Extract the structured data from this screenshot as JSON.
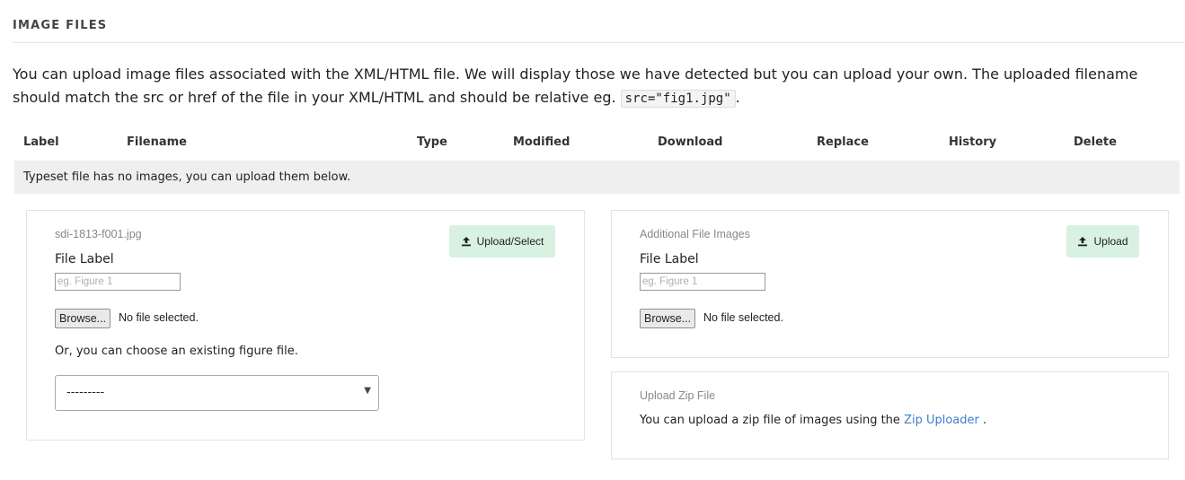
{
  "section": {
    "title": "IMAGE FILES"
  },
  "intro": {
    "text_before": "You can upload image files associated with the XML/HTML file. We will display those we have detected but you can upload your own. The uploaded filename should match the src or href of the file in your XML/HTML and should be relative eg. ",
    "code": "src=\"fig1.jpg\"",
    "text_after": "."
  },
  "table": {
    "headers": {
      "label": "Label",
      "filename": "Filename",
      "type": "Type",
      "modified": "Modified",
      "download": "Download",
      "replace": "Replace",
      "history": "History",
      "delete": "Delete"
    },
    "empty_message": "Typeset file has no images, you can upload them below."
  },
  "left_panel": {
    "filename": "sdi-1813-f001.jpg",
    "upload_label": "Upload/Select",
    "file_label": "File Label",
    "file_label_placeholder": "eg. Figure 1",
    "browse_label": "Browse...",
    "no_file_text": "No file selected.",
    "choose_text": "Or, you can choose an existing figure file.",
    "select_value": "---------"
  },
  "right_panel": {
    "title": "Additional File Images",
    "upload_label": "Upload",
    "file_label": "File Label",
    "file_label_placeholder": "eg. Figure 1",
    "browse_label": "Browse...",
    "no_file_text": "No file selected."
  },
  "zip_panel": {
    "title": "Upload Zip File",
    "text_before": "You can upload a zip file of images using the ",
    "link_text": "Zip Uploader",
    "text_after": " ."
  },
  "colors": {
    "accent_button": "#d8f1e0",
    "link": "#3f7fc9",
    "empty_row_bg": "#efefef"
  }
}
